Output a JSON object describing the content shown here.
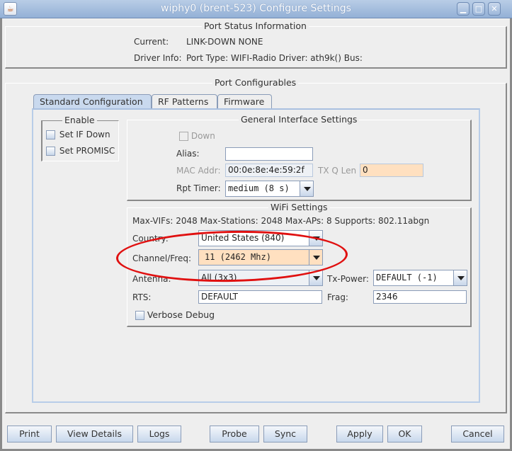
{
  "window": {
    "title": "wiphy0  (brent-523) Configure Settings",
    "controls": [
      "minimize",
      "maximize",
      "close"
    ]
  },
  "port_status": {
    "legend": "Port Status Information",
    "current_label": "Current:",
    "current_value": "LINK-DOWN  NONE",
    "driver_label": "Driver Info:",
    "driver_value": "Port Type: WIFI-Radio   Driver: ath9k()  Bus:"
  },
  "port_configurables": {
    "legend": "Port Configurables",
    "tabs": [
      {
        "label": "Standard Configuration",
        "active": true
      },
      {
        "label": "RF Patterns",
        "active": false
      },
      {
        "label": "Firmware",
        "active": false
      }
    ]
  },
  "enable": {
    "legend": "Enable",
    "set_if_down": {
      "label": "Set IF Down",
      "checked": false
    },
    "set_promisc": {
      "label": "Set PROMISC",
      "checked": false
    }
  },
  "general": {
    "legend": "General Interface Settings",
    "down": {
      "label": "Down",
      "checked": false,
      "disabled": true
    },
    "alias_label": "Alias:",
    "alias_value": "",
    "mac_label": "MAC Addr:",
    "mac_value": "00:0e:8e:4e:59:2f",
    "txq_label": "TX Q Len",
    "txq_value": "0",
    "rpt_label": "Rpt Timer:",
    "rpt_value": "medium  (8 s)"
  },
  "wifi": {
    "legend": "WiFi Settings",
    "caps": "Max-VIFs: 2048  Max-Stations: 2048  Max-APs: 8  Supports: 802.11abgn",
    "country_label": "Country:",
    "country_value": "United States (840)",
    "channel_label": "Channel/Freq:",
    "channel_value": "11  (2462 Mhz)",
    "antenna_label": "Antenna:",
    "antenna_value": "All (3x3)",
    "txpower_label": "Tx-Power:",
    "txpower_value": "DEFAULT  (-1)",
    "rts_label": "RTS:",
    "rts_value": "DEFAULT",
    "frag_label": "Frag:",
    "frag_value": "2346",
    "verbose": {
      "label": "Verbose Debug",
      "checked": false
    },
    "highlight_color": "#e01010"
  },
  "buttons": {
    "print": "Print",
    "view_details": "View Details",
    "logs": "Logs",
    "probe": "Probe",
    "sync": "Sync",
    "apply": "Apply",
    "ok": "OK",
    "cancel": "Cancel"
  }
}
